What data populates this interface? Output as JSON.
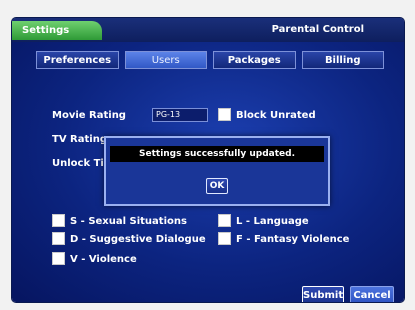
{
  "header": {
    "tab_label": "Settings",
    "section_title": "Parental Control"
  },
  "tabs": [
    {
      "label": "Preferences",
      "active": false
    },
    {
      "label": "Users",
      "active": true
    },
    {
      "label": "Packages",
      "active": false
    },
    {
      "label": "Billing",
      "active": false
    }
  ],
  "form": {
    "movie_rating_label": "Movie Rating",
    "movie_rating_value": "PG-13",
    "block_unrated_label": "Block Unrated",
    "tv_rating_label": "TV Rating",
    "unlock_time_label": "Unlock Tim"
  },
  "content_filters": [
    {
      "label": "S - Sexual Situations",
      "checked": false
    },
    {
      "label": "L - Language",
      "checked": false
    },
    {
      "label": "D - Suggestive Dialogue",
      "checked": false
    },
    {
      "label": "F - Fantasy Violence",
      "checked": false
    },
    {
      "label": "V - Violence",
      "checked": false
    }
  ],
  "buttons": {
    "submit": "Submit",
    "cancel": "Cancel"
  },
  "dialog": {
    "message": "Settings successfully updated.",
    "ok": "OK"
  }
}
